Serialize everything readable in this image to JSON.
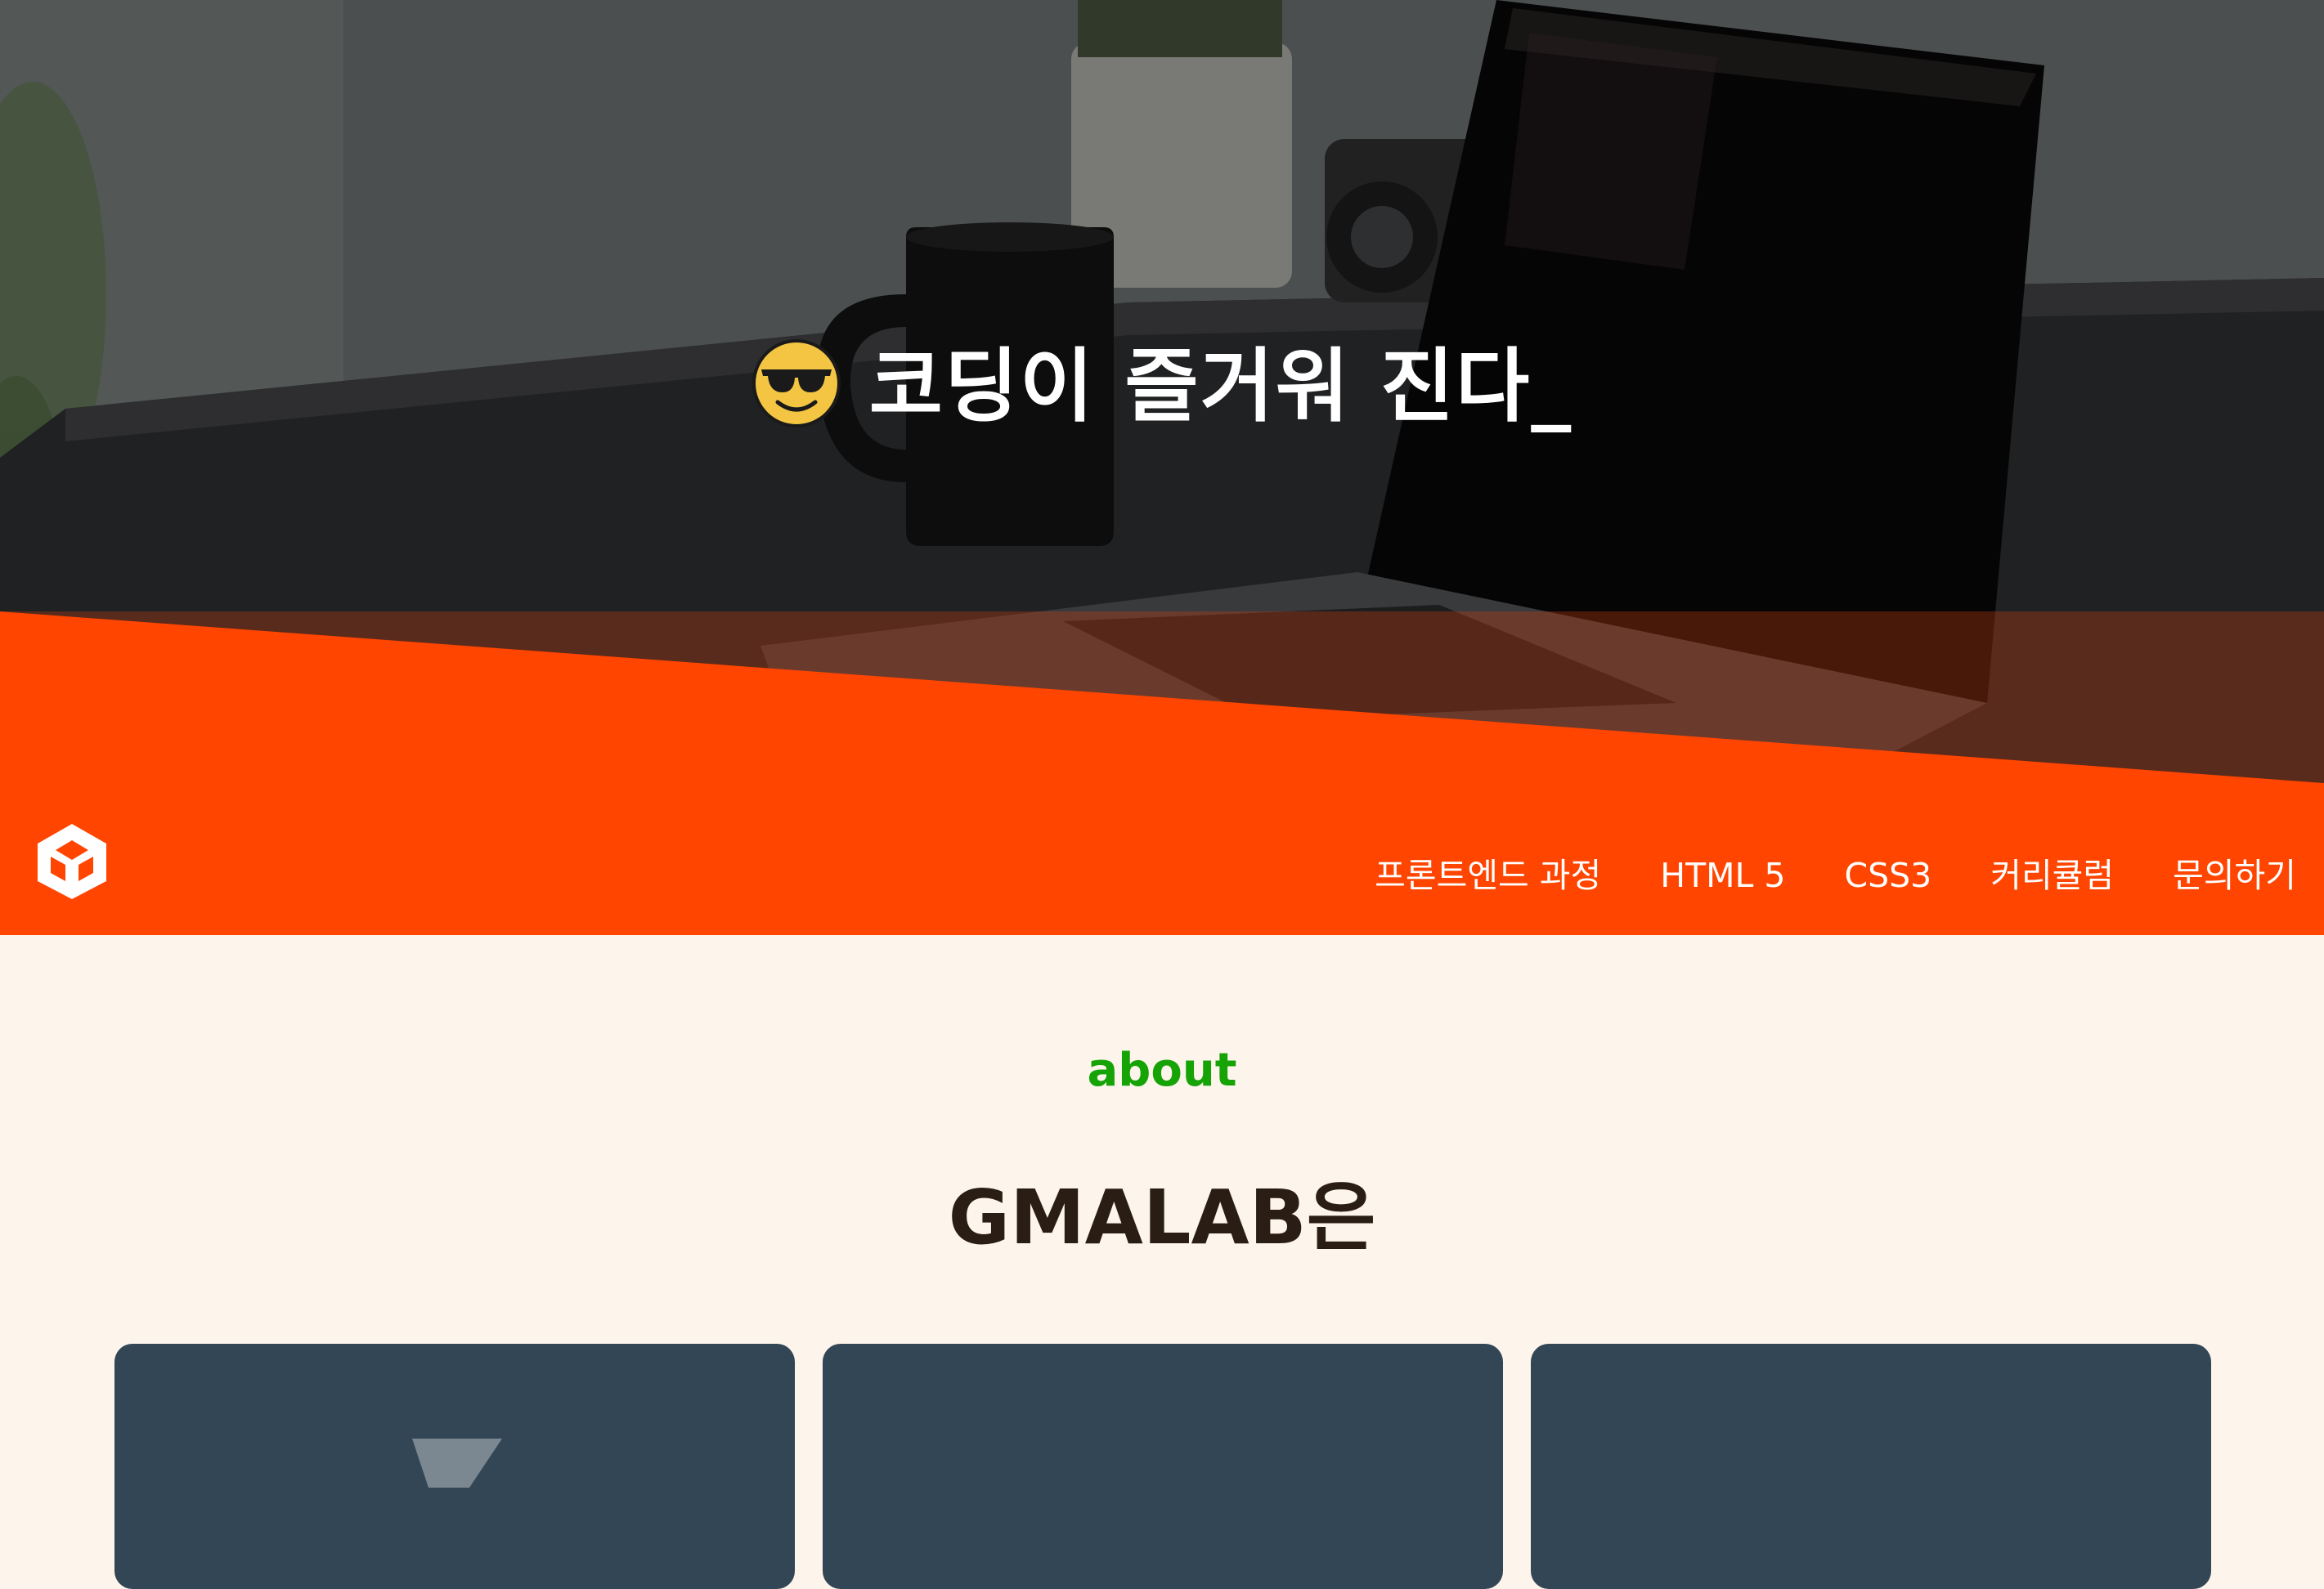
{
  "hero": {
    "headline": "코딩이 즐거워 진다",
    "cursor": "_",
    "emoji": "smiling-face-with-sunglasses"
  },
  "colors": {
    "accent_orange": "#ff4500",
    "eyebrow_green": "#16a306",
    "background_cream": "#fdf4ec",
    "card_slate": "#324655",
    "title_dark": "#2a1d14"
  },
  "nav": {
    "logo_icon": "cube-logo",
    "items": [
      {
        "label": "프론트엔드 과정"
      },
      {
        "label": "HTML 5"
      },
      {
        "label": "CSS3"
      },
      {
        "label": "커리큘럼"
      },
      {
        "label": "문의하기"
      }
    ]
  },
  "about": {
    "eyebrow": "about",
    "title": "GMALAB은"
  },
  "cards": [
    {
      "icon": "card-graphic-icon"
    },
    {
      "icon": ""
    },
    {
      "icon": ""
    }
  ]
}
